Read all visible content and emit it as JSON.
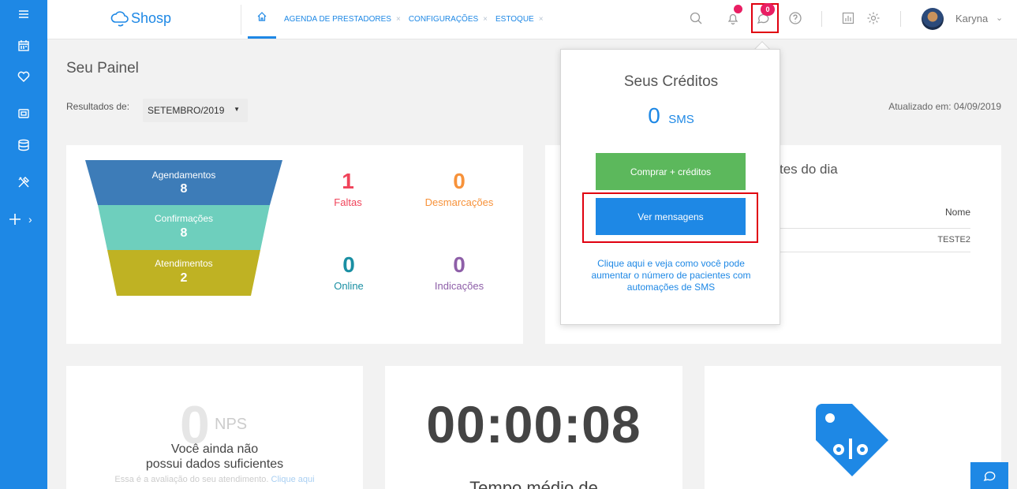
{
  "sidebar": {
    "items": [
      {
        "icon": "menu-icon"
      },
      {
        "icon": "calendar-icon"
      },
      {
        "icon": "heart-icon"
      },
      {
        "icon": "money-icon"
      },
      {
        "icon": "database-icon"
      },
      {
        "icon": "tools-icon"
      },
      {
        "icon": "plus-icon"
      }
    ],
    "expand_arrow": "›"
  },
  "header": {
    "logo_text": "Shosp",
    "tabs": [
      {
        "label": "AGENDA DE PRESTADORES",
        "close": "×"
      },
      {
        "label": "CONFIGURAÇÕES",
        "close": "×"
      },
      {
        "label": "ESTOQUE",
        "close": "×"
      }
    ],
    "chat_badge": "0",
    "user_name": "Karyna",
    "user_caret": "⌄"
  },
  "dashboard": {
    "title": "Seu Painel",
    "results_label": "Resultados de:",
    "period_value": "SETEMBRO/2019",
    "period_caret": "▼",
    "updated": "Atualizado em: 04/09/2019",
    "funnel": [
      {
        "label": "Agendamentos",
        "value": "8",
        "color": "#3d7cb8"
      },
      {
        "label": "Confirmações",
        "value": "8",
        "color": "#6ecfbd"
      },
      {
        "label": "Atendimentos",
        "value": "2",
        "color": "#bfb223"
      }
    ],
    "stats": [
      {
        "value": "1",
        "label": "Faltas",
        "color": "#f0435a"
      },
      {
        "value": "0",
        "label": "Desmarcações",
        "color": "#f7923a"
      },
      {
        "value": "0",
        "label": "Online",
        "color": "#1a8fa3"
      },
      {
        "value": "0",
        "label": "Indicações",
        "color": "#8e5fa8"
      }
    ]
  },
  "patients_card": {
    "title_fragment": "tes do dia",
    "column_name": "Nome",
    "rows": [
      "TESTE2"
    ]
  },
  "credits_popover": {
    "title": "Seus Créditos",
    "credits_value": "0",
    "credits_unit": "SMS",
    "buy_button": "Comprar + créditos",
    "messages_button": "Ver mensagens",
    "info_link": "Clique aqui e veja como você pode aumentar o número de pacientes com automações de SMS"
  },
  "nps_card": {
    "score": "0",
    "label": "NPS",
    "message_line1": "Você ainda não",
    "message_line2": "possui dados suficientes",
    "note": "Essa é a avaliação do seu atendimento.",
    "note_link": "Clique aqui"
  },
  "time_card": {
    "time": "00:00:08",
    "label": "Tempo médio de"
  },
  "colors": {
    "primary": "#1e88e5",
    "buy_green": "#5cb85c",
    "badge_pink": "#e91e63",
    "highlight_red": "#e0000f"
  }
}
